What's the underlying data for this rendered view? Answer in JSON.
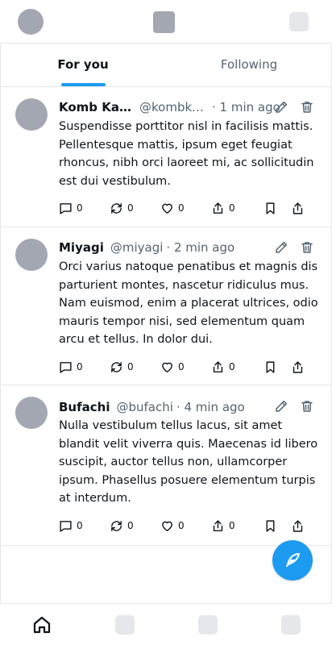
{
  "header": {
    "avatar_icon": "profile-avatar",
    "logo_icon": "app-logo",
    "settings_icon": "settings-placeholder"
  },
  "tabs": [
    {
      "label": "For you",
      "active": true
    },
    {
      "label": "Following",
      "active": false
    }
  ],
  "posts": [
    {
      "name": "Komb Kar…",
      "handle": "@kombka…",
      "time": "· 1 min ago",
      "body": "Suspendisse porttitor nisl in facilisis mattis. Pellentesque mattis, ipsum eget feugiat rhoncus, nibh orci laoreet mi, ac sollicitudin est dui vestibulum.",
      "replies": "0",
      "reposts": "0",
      "likes": "0",
      "views": "0"
    },
    {
      "name": "Miyagi",
      "handle": "@miyagi",
      "time": "· 2 min ago",
      "body": "Orci varius natoque penatibus et magnis dis parturient montes, nascetur ridiculus mus. Nam euismod, enim a placerat ultrices, odio mauris tempor nisi, sed elementum quam arcu et tellus. In dolor dui.",
      "replies": "0",
      "reposts": "0",
      "likes": "0",
      "views": "0"
    },
    {
      "name": "Bufachi",
      "handle": "@bufachi",
      "time": "· 4 min ago",
      "body": "Nulla vestibulum tellus lacus, sit amet blandit velit viverra quis. Maecenas id libero suscipit, auctor tellus non, ullamcorper ipsum. Phasellus posuere elementum turpis at interdum.",
      "replies": "0",
      "reposts": "0",
      "likes": "0",
      "views": "0"
    }
  ],
  "fab": {
    "icon": "compose-feather-icon"
  },
  "bottom_nav": [
    {
      "icon": "home-icon",
      "active": true
    },
    {
      "icon": "search-placeholder",
      "active": false
    },
    {
      "icon": "notifications-placeholder",
      "active": false
    },
    {
      "icon": "messages-placeholder",
      "active": false
    }
  ],
  "colors": {
    "accent": "#1d9bf0",
    "text": "#0f1419",
    "muted": "#536471",
    "border": "#e5e7eb",
    "placeholder": "#a2a7b2"
  }
}
